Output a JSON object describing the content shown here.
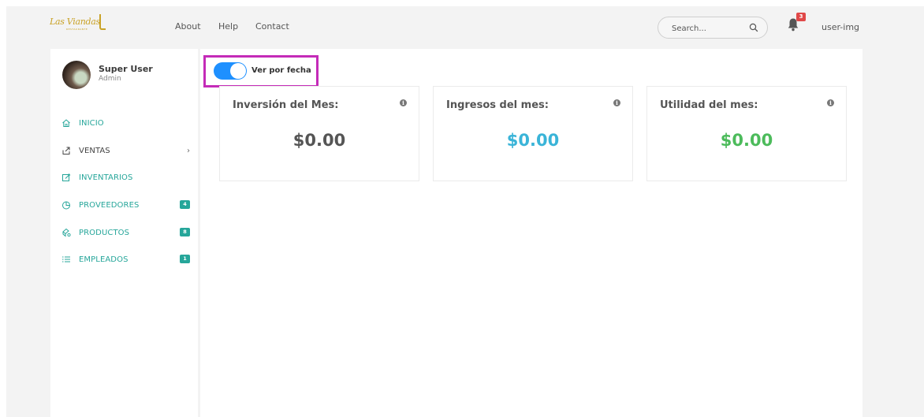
{
  "navbar": {
    "logo_text": "Las Viandas",
    "logo_sub": "RESTAURANTE",
    "links": [
      "About",
      "Help",
      "Contact"
    ],
    "search_placeholder": "Search...",
    "notifications_count": "3",
    "user_label": "user-img"
  },
  "sidebar": {
    "user_name": "Super User",
    "user_role": "Admin",
    "items": [
      {
        "label": "INICIO",
        "icon": "home-icon"
      },
      {
        "label": "VENTAS",
        "icon": "share-icon"
      },
      {
        "label": "INVENTARIOS",
        "icon": "edit-icon"
      },
      {
        "label": "PROVEEDORES",
        "icon": "pie-chart-icon",
        "badge": "4"
      },
      {
        "label": "PRODUCTOS",
        "icon": "products-icon",
        "badge": "8"
      },
      {
        "label": "EMPLEADOS",
        "icon": "list-icon",
        "badge": "1"
      }
    ]
  },
  "main": {
    "toggle_label": "Ver por fecha",
    "toggle_on": true,
    "cards": [
      {
        "title": "Inversión del Mes:",
        "value": "$0.00",
        "color": "#555555"
      },
      {
        "title": "Ingresos del mes:",
        "value": "$0.00",
        "color": "#3ab4d8"
      },
      {
        "title": "Utilidad del mes:",
        "value": "$0.00",
        "color": "#4cbb5b"
      }
    ]
  },
  "colors": {
    "accent": "#26a69a",
    "toggle": "#1e90ff",
    "highlight": "#c42bb8",
    "badge": "#e04848"
  }
}
